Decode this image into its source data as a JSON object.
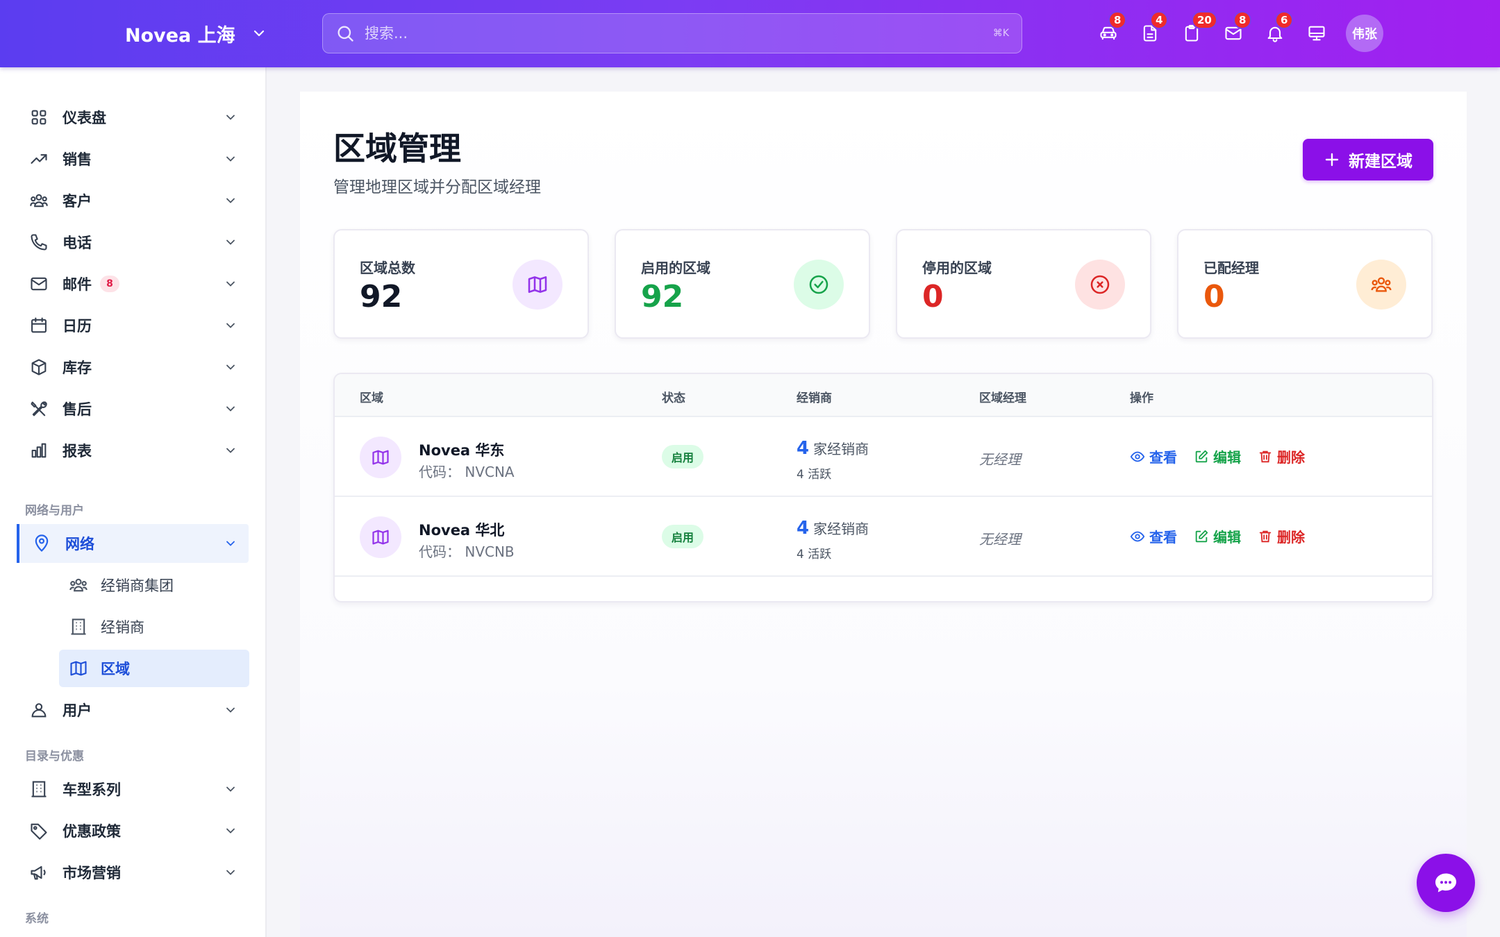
{
  "header": {
    "brand": "Novea 上海",
    "search_placeholder": "搜索...",
    "search_shortcut": "⌘K",
    "icons": [
      {
        "name": "car-icon",
        "badge": "8"
      },
      {
        "name": "document-icon",
        "badge": "4"
      },
      {
        "name": "clipboard-icon",
        "badge": "20"
      },
      {
        "name": "mail-icon",
        "badge": "8"
      },
      {
        "name": "bell-icon",
        "badge": "6"
      },
      {
        "name": "monitor-icon",
        "badge": ""
      }
    ],
    "avatar": "伟张"
  },
  "sidebar": {
    "items": [
      {
        "label": "仪表盘",
        "icon": "grid-icon"
      },
      {
        "label": "销售",
        "icon": "trending-up-icon"
      },
      {
        "label": "客户",
        "icon": "users-icon"
      },
      {
        "label": "电话",
        "icon": "phone-icon"
      },
      {
        "label": "邮件",
        "icon": "mail-icon",
        "badge": "8"
      },
      {
        "label": "日历",
        "icon": "calendar-icon"
      },
      {
        "label": "库存",
        "icon": "box-icon"
      },
      {
        "label": "售后",
        "icon": "tools-icon"
      },
      {
        "label": "报表",
        "icon": "bar-chart-icon"
      }
    ],
    "section_network": "网络与用户",
    "network": {
      "label": "网络",
      "icon": "location-pin-icon"
    },
    "network_sub": [
      {
        "label": "经销商集团",
        "icon": "users-icon"
      },
      {
        "label": "经销商",
        "icon": "building-icon"
      },
      {
        "label": "区域",
        "icon": "map-icon"
      }
    ],
    "users": {
      "label": "用户",
      "icon": "user-icon"
    },
    "section_catalog": "目录与优惠",
    "catalog": [
      {
        "label": "车型系列",
        "icon": "building-icon"
      },
      {
        "label": "优惠政策",
        "icon": "tag-icon"
      },
      {
        "label": "市场营销",
        "icon": "megaphone-icon"
      }
    ],
    "section_system": "系统"
  },
  "page": {
    "title": "区域管理",
    "subtitle": "管理地理区域并分配区域经理",
    "new_button": "新建区域"
  },
  "stats": [
    {
      "label": "区域总数",
      "value": "92",
      "color": "#111827",
      "icon": "map-icon",
      "icon_bg": "#f3e8ff",
      "icon_color": "#9333ea"
    },
    {
      "label": "启用的区域",
      "value": "92",
      "color": "#16a34a",
      "icon": "check-circle-icon",
      "icon_bg": "#dcfce7",
      "icon_color": "#16a34a"
    },
    {
      "label": "停用的区域",
      "value": "0",
      "color": "#dc2626",
      "icon": "x-circle-icon",
      "icon_bg": "#fee2e2",
      "icon_color": "#dc2626"
    },
    {
      "label": "已配经理",
      "value": "0",
      "color": "#ea580c",
      "icon": "users-icon",
      "icon_bg": "#ffedd5",
      "icon_color": "#ea580c"
    }
  ],
  "table": {
    "headers": [
      "区域",
      "状态",
      "经销商",
      "区域经理",
      "操作"
    ],
    "rows": [
      {
        "name": "Novea 华东",
        "code": "代码： NVCNA",
        "status": "启用",
        "dealer_count": "4",
        "dealer_unit": "家经销商",
        "dealer_active": "4 活跃",
        "manager": "无经理"
      },
      {
        "name": "Novea 华北",
        "code": "代码： NVCNB",
        "status": "启用",
        "dealer_count": "4",
        "dealer_unit": "家经销商",
        "dealer_active": "4 活跃",
        "manager": "无经理"
      }
    ],
    "actions": {
      "view": "查看",
      "edit": "编辑",
      "delete": "删除"
    }
  },
  "chat_fab_icon": "chat-icon"
}
